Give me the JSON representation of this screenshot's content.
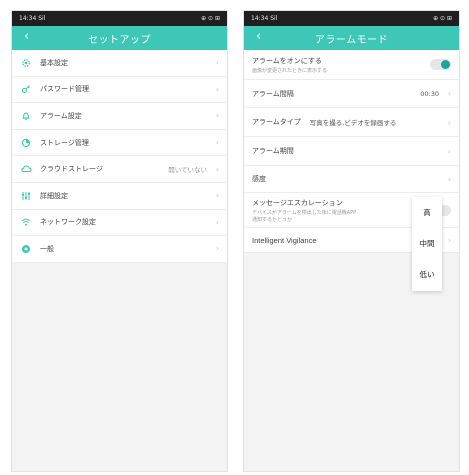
{
  "left": {
    "status": {
      "time": "14:34",
      "signal": "Sil",
      "icons": "⊕ ⊙ ⊞"
    },
    "header": {
      "back_icon": "chevron-left-icon",
      "title": "セットアップ"
    },
    "menu": [
      {
        "label": "基本設定",
        "value": "",
        "icon": "gear-icon",
        "color": "#3ec7b6"
      },
      {
        "label": "パスワード管理",
        "value": "",
        "icon": "key-icon",
        "color": "#3ec7b6"
      },
      {
        "label": "アラーム設定",
        "value": "",
        "icon": "bell-icon",
        "color": "#3ec7b6"
      },
      {
        "label": "ストレージ管理",
        "value": "",
        "icon": "storage-icon",
        "color": "#3ec7b6"
      },
      {
        "label": "クラウドストレージ",
        "value": "開いていない",
        "icon": "cloud-icon",
        "color": "#3ec7b6"
      },
      {
        "label": "詳細設定",
        "value": "",
        "icon": "sliders-icon",
        "color": "#3ec7b6"
      },
      {
        "label": "ネットワーク設定",
        "value": "",
        "icon": "wifi-icon",
        "color": "#3ec7b6"
      },
      {
        "label": "一般",
        "value": "",
        "icon": "general-icon",
        "color": "#3ec7b6"
      }
    ]
  },
  "right": {
    "status": {
      "time": "14:34",
      "signal": "Sil",
      "icons": "⊕ ⊙ ⊞"
    },
    "header": {
      "back_icon": "chevron-left-icon",
      "title": "アラームモード"
    },
    "alarm_on": {
      "label": "アラームをオンにする",
      "sub": "画像が変更されたときに表示する",
      "enabled": true
    },
    "interval": {
      "label": "アラーム間隔",
      "value": "00:30"
    },
    "type": {
      "label": "アラームタイプ",
      "value": "写真を撮る,ビデオを録画する"
    },
    "period": {
      "label": "アラーム期間"
    },
    "sensitivity": {
      "label": "感度"
    },
    "escalation": {
      "label": "メッセージエスカレーション",
      "sub1": "デバイスがアラームを検出した後に電話機APP",
      "sub2": "通知するかどうか"
    },
    "vigilance": {
      "label": "Intelligent Vigilance"
    },
    "popup": {
      "options": [
        "高",
        "中間",
        "低い"
      ]
    },
    "accent": "#3ec7b6"
  }
}
